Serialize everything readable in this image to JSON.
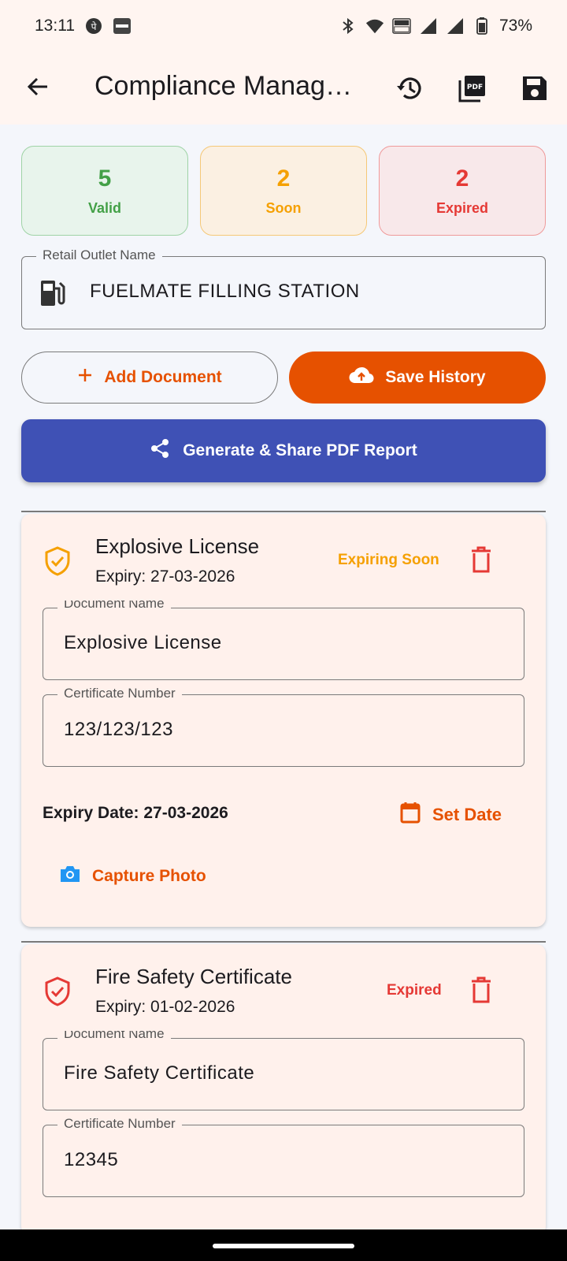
{
  "status_bar": {
    "time": "13:11",
    "battery": "73%",
    "left_icons": [
      "phonepe-icon",
      "paytm-icon"
    ],
    "right_icons": [
      "bluetooth-icon",
      "wifi-icon",
      "volte-icon",
      "signal-icon",
      "signal-icon",
      "battery-icon"
    ]
  },
  "app_bar": {
    "title": "Compliance Management",
    "actions": [
      "history-icon",
      "pdf-icon",
      "save-icon"
    ]
  },
  "stats": {
    "valid": {
      "count": "5",
      "label": "Valid",
      "color": "#43a047"
    },
    "soon": {
      "count": "2",
      "label": "Soon",
      "color": "#f5a000"
    },
    "expired": {
      "count": "2",
      "label": "Expired",
      "color": "#e53935"
    }
  },
  "outlet": {
    "label": "Retail Outlet Name",
    "value": "FUELMATE FILLING STATION"
  },
  "buttons": {
    "add_document": "Add Document",
    "save_history": "Save History",
    "generate_pdf": "Generate & Share PDF Report"
  },
  "documents": [
    {
      "title": "Explosive License",
      "expiry_line": "Expiry: 27-03-2026",
      "status": "Expiring Soon",
      "status_color": "#f5a000",
      "name_label": "Document Name",
      "name_value": "Explosive License",
      "cert_label": "Certificate Number",
      "cert_value": "123/123/123",
      "expiry_date": "Expiry Date: 27-03-2026",
      "set_date": "Set Date",
      "capture": "Capture Photo"
    },
    {
      "title": "Fire Safety Certificate",
      "expiry_line": "Expiry: 01-02-2026",
      "status": "Expired",
      "status_color": "#e53935",
      "name_label": "Document Name",
      "name_value": "Fire Safety Certificate",
      "cert_label": "Certificate Number",
      "cert_value": "12345"
    }
  ],
  "theme": {
    "accent": "#e65100",
    "primary_button": "#3f51b5"
  }
}
